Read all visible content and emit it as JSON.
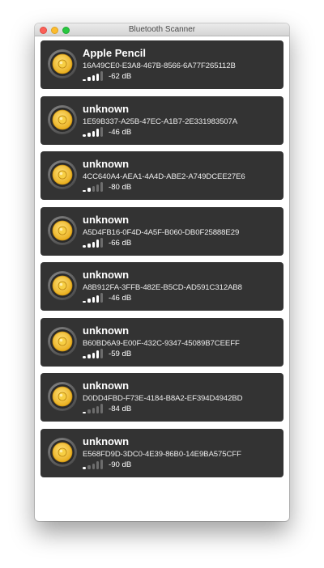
{
  "window": {
    "title": "Bluetooth Scanner"
  },
  "devices": [
    {
      "name": "Apple Pencil",
      "uuid": "16A49CE0-E3A8-467B-8566-6A77F265112B",
      "rssi": "-62 dB",
      "bars": 4
    },
    {
      "name": "unknown",
      "uuid": "1E59B337-A25B-47EC-A1B7-2E331983507A",
      "rssi": "-46 dB",
      "bars": 4
    },
    {
      "name": "unknown",
      "uuid": "4CC640A4-AEA1-4A4D-ABE2-A749DCEE27E6",
      "rssi": "-80 dB",
      "bars": 2
    },
    {
      "name": "unknown",
      "uuid": "A5D4FB16-0F4D-4A5F-B060-DB0F25888E29",
      "rssi": "-66 dB",
      "bars": 4
    },
    {
      "name": "unknown",
      "uuid": "A8B912FA-3FFB-482E-B5CD-AD591C312AB8",
      "rssi": "-46 dB",
      "bars": 4
    },
    {
      "name": "unknown",
      "uuid": "B60BD6A9-E00F-432C-9347-45089B7CEEFF",
      "rssi": "-59 dB",
      "bars": 4
    },
    {
      "name": "unknown",
      "uuid": "D0DD4FBD-F73E-4184-B8A2-EF394D4942BD",
      "rssi": "-84 dB",
      "bars": 1
    },
    {
      "name": "unknown",
      "uuid": "E568FD9D-3DC0-4E39-86B0-14E9BA575CFF",
      "rssi": "-90 dB",
      "bars": 1
    }
  ],
  "icons": {
    "device": "speaker-icon",
    "signal": "signal-strength-icon"
  },
  "colors": {
    "card": "#333333",
    "speaker_cone": "#f2c12e",
    "signal_on": "#ffffff",
    "signal_off": "#6d6d6d"
  }
}
